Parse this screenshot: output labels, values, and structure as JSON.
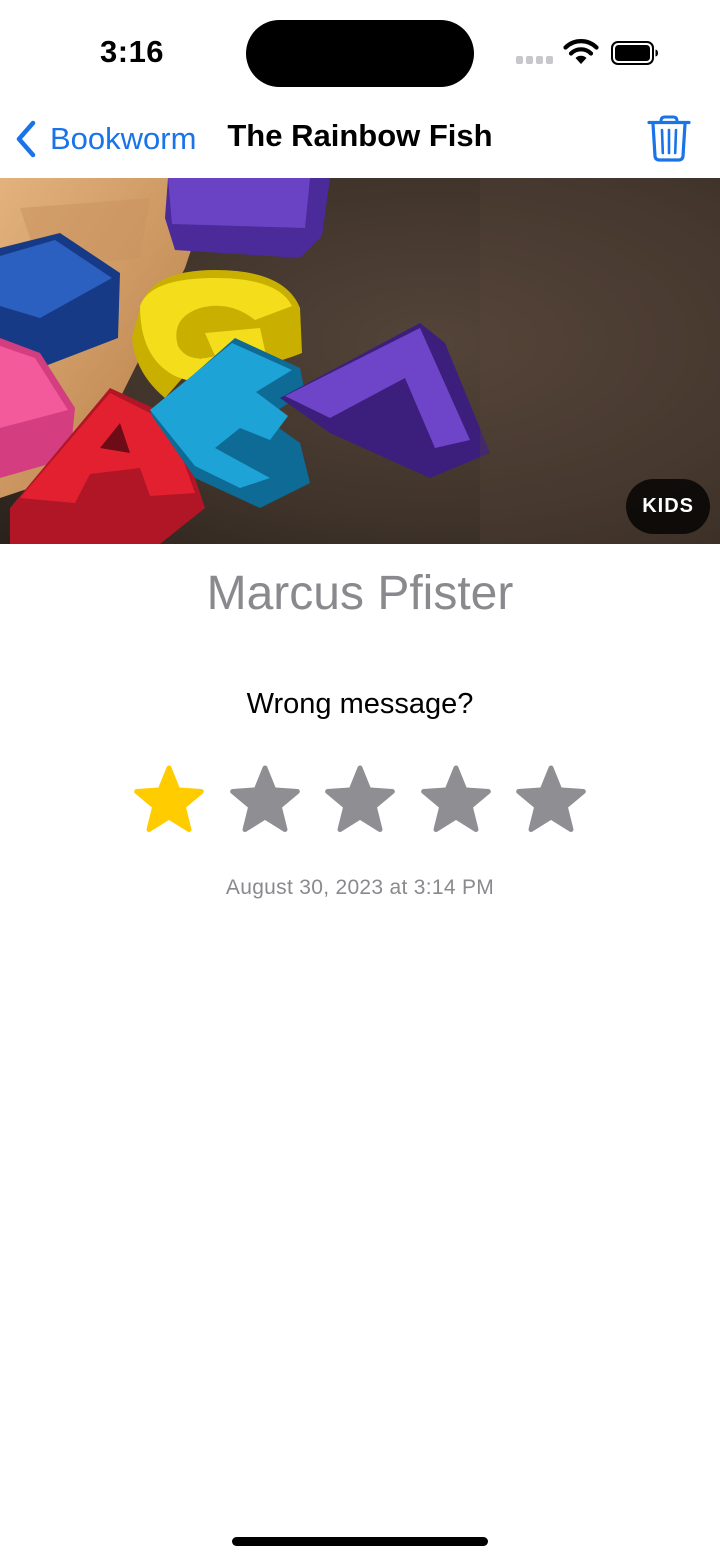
{
  "status_bar": {
    "time": "3:16"
  },
  "nav": {
    "back_label": "Bookworm",
    "title": "The Rainbow Fish",
    "accent_color": "#1a73e8"
  },
  "book": {
    "genre_badge": "KIDS",
    "author": "Marcus Pfister",
    "review": "Wrong message?",
    "rating": 1,
    "rating_max": 5,
    "date": "August 30, 2023 at 3:14 PM"
  },
  "colors": {
    "star_on": "#ffcc00",
    "star_off": "#8e8e93",
    "secondary_text": "#8a8a8e"
  }
}
